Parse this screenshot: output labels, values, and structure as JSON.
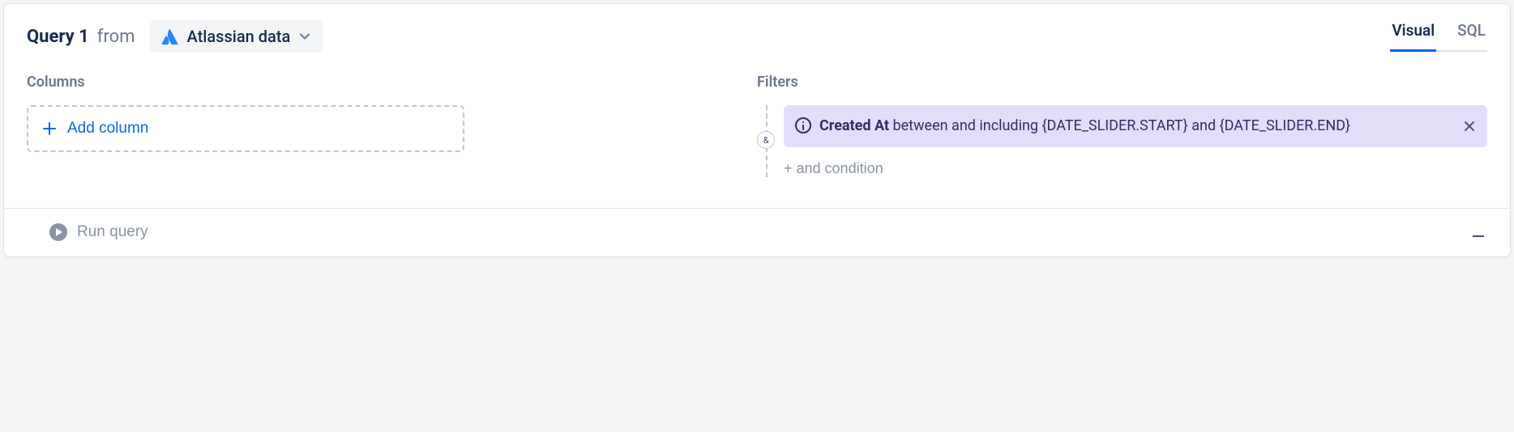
{
  "query": {
    "title": "Query 1",
    "from_label": "from",
    "source": {
      "name": "Atlassian data"
    }
  },
  "tabs": {
    "visual": "Visual",
    "sql": "SQL",
    "active": "visual"
  },
  "columns": {
    "label": "Columns",
    "add_button": "Add column"
  },
  "filters": {
    "label": "Filters",
    "and_symbol": "&",
    "conditions": [
      {
        "field": "Created At",
        "operator_text": " between and including {DATE_SLIDER.START} and {DATE_SLIDER.END}"
      }
    ],
    "add_condition": "+ and condition"
  },
  "footer": {
    "run_button": "Run query"
  }
}
